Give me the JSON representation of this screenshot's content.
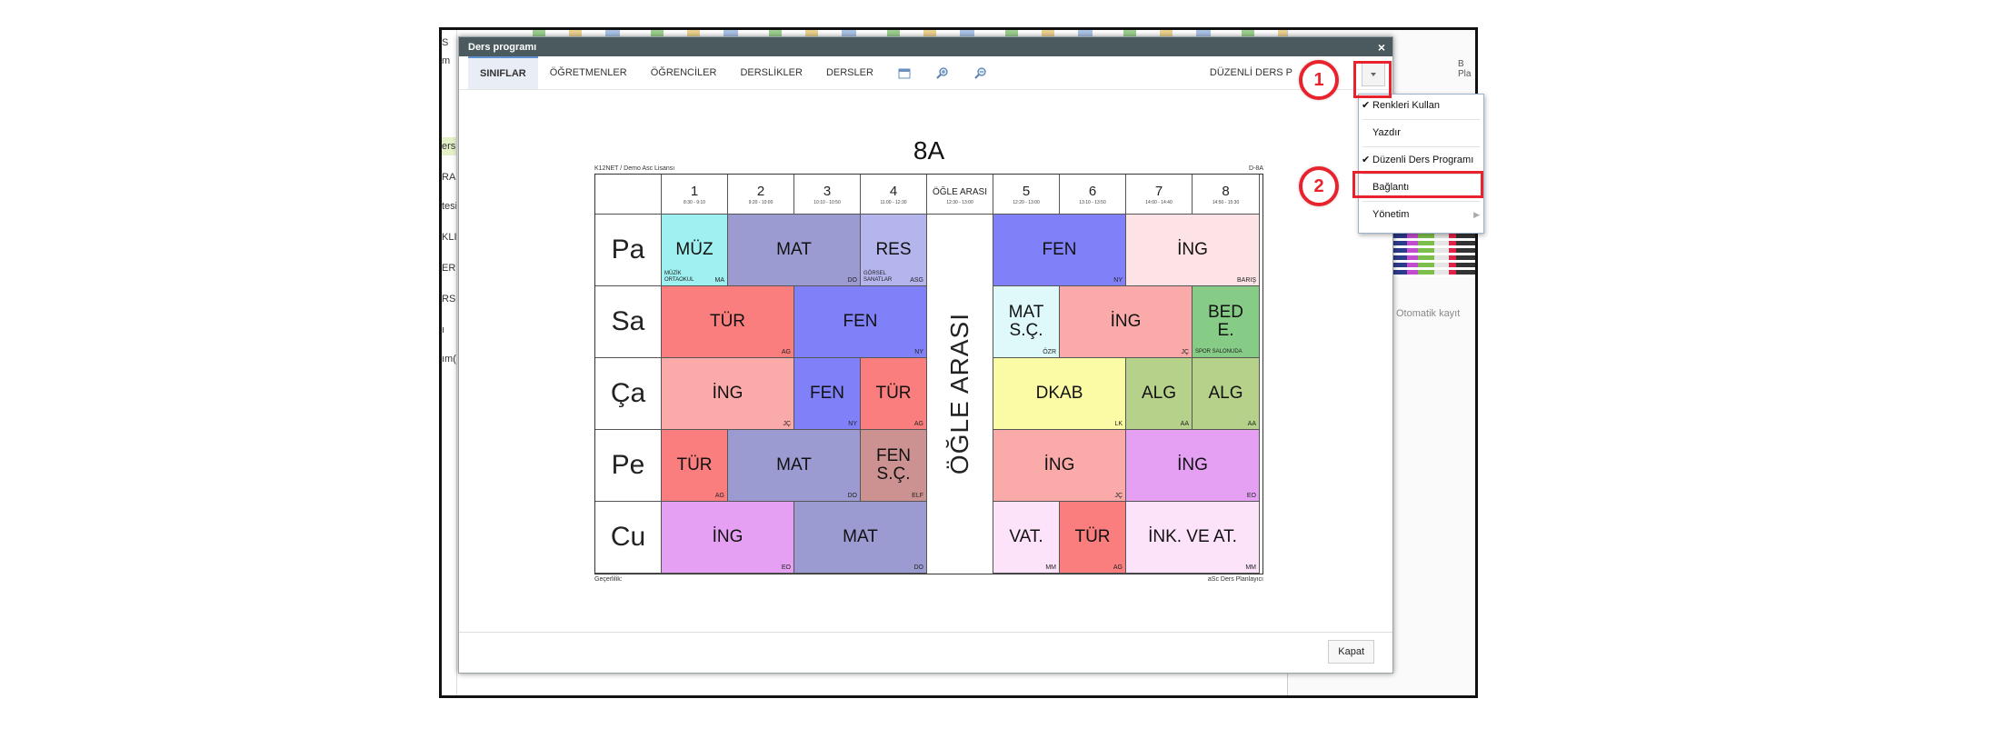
{
  "background": {
    "left_texts": [
      "S",
      "m",
      "ers",
      "RA",
      "tesi",
      "KLI",
      "ER",
      "RS",
      "ı",
      "ım("
    ],
    "right_small": "B\nPla",
    "auto_save": "Otomatik kayıt"
  },
  "dialog": {
    "title": "Ders programı",
    "close_glyph": "×",
    "mode_label": "DÜZENLİ DERS P",
    "close_button": "Kapat"
  },
  "tabs": [
    {
      "label": "SINIFLAR",
      "active": true
    },
    {
      "label": "ÖĞRETMENLER",
      "active": false
    },
    {
      "label": "ÖĞRENCİLER",
      "active": false
    },
    {
      "label": "DERSLİKLER",
      "active": false
    },
    {
      "label": "DERSLER",
      "active": false
    }
  ],
  "timetable": {
    "title": "8A",
    "license": "K12NET / Demo Asc Lisansı",
    "code": "D-8A",
    "validity": "Geçerlilik:",
    "footer_brand": "aSc Ders Planlayıcı",
    "lunch_header": "ÖĞLE ARASI",
    "lunch_time": "12:30 - 13:00",
    "lunch_vertical": "ÖĞLE ARASI",
    "periods": [
      {
        "num": "1",
        "time": "8:30 - 9:10"
      },
      {
        "num": "2",
        "time": "9:20 - 10:00"
      },
      {
        "num": "3",
        "time": "10:10 - 10:50"
      },
      {
        "num": "4",
        "time": "11:00 - 12:30"
      },
      {
        "num": "5",
        "time": "12:20 - 13:00"
      },
      {
        "num": "6",
        "time": "13:10 - 13:50"
      },
      {
        "num": "7",
        "time": "14:00 - 14:40"
      },
      {
        "num": "8",
        "time": "14:50 - 15:30"
      }
    ],
    "days": [
      "Pa",
      "Sa",
      "Ça",
      "Pe",
      "Cu"
    ],
    "lessons": [
      {
        "day": 0,
        "col": 2,
        "span": 1,
        "name": "MÜZ",
        "teacher": "MA",
        "room": "MÜZİK\nORTAOKUL",
        "color": "#9ff0f0"
      },
      {
        "day": 0,
        "col": 3,
        "span": 2,
        "name": "MAT",
        "teacher": "DO",
        "room": "",
        "color": "#9b9bd2"
      },
      {
        "day": 0,
        "col": 5,
        "span": 1,
        "name": "RES",
        "teacher": "ASG",
        "room": "GÖRSEL\nSANATLAR",
        "color": "#b5b5ee"
      },
      {
        "day": 0,
        "col": 7,
        "span": 2,
        "name": "FEN",
        "teacher": "NY",
        "room": "",
        "color": "#8080f8"
      },
      {
        "day": 0,
        "col": 9,
        "span": 2,
        "name": "İNG",
        "teacher": "BARIŞ",
        "room": "",
        "color": "#fde2e6"
      },
      {
        "day": 1,
        "col": 2,
        "span": 2,
        "name": "TÜR",
        "teacher": "AG",
        "room": "",
        "color": "#fa7e7e"
      },
      {
        "day": 1,
        "col": 4,
        "span": 2,
        "name": "FEN",
        "teacher": "NY",
        "room": "",
        "color": "#8080f8"
      },
      {
        "day": 1,
        "col": 7,
        "span": 1,
        "name": "MAT\nS.Ç.",
        "teacher": "ÖZR",
        "room": "",
        "color": "#dff9fb"
      },
      {
        "day": 1,
        "col": 8,
        "span": 2,
        "name": "İNG",
        "teacher": "JÇ",
        "room": "",
        "color": "#fbaaaa"
      },
      {
        "day": 1,
        "col": 10,
        "span": 1,
        "name": "BED\nE.",
        "teacher": "",
        "room": "SPOR SALONUDA",
        "color": "#86cc86"
      },
      {
        "day": 2,
        "col": 2,
        "span": 2,
        "name": "İNG",
        "teacher": "JÇ",
        "room": "",
        "color": "#fbaaaa"
      },
      {
        "day": 2,
        "col": 4,
        "span": 1,
        "name": "FEN",
        "teacher": "NY",
        "room": "",
        "color": "#8080f8"
      },
      {
        "day": 2,
        "col": 5,
        "span": 1,
        "name": "TÜR",
        "teacher": "AG",
        "room": "",
        "color": "#fa7e7e"
      },
      {
        "day": 2,
        "col": 7,
        "span": 2,
        "name": "DKAB",
        "teacher": "LK",
        "room": "",
        "color": "#fbfba6"
      },
      {
        "day": 2,
        "col": 9,
        "span": 1,
        "name": "ALG",
        "teacher": "AA",
        "room": "",
        "color": "#b6d18a"
      },
      {
        "day": 2,
        "col": 10,
        "span": 1,
        "name": "ALG",
        "teacher": "AA",
        "room": "",
        "color": "#b6d18a"
      },
      {
        "day": 3,
        "col": 2,
        "span": 1,
        "name": "TÜR",
        "teacher": "AG",
        "room": "",
        "color": "#fa7e7e"
      },
      {
        "day": 3,
        "col": 3,
        "span": 2,
        "name": "MAT",
        "teacher": "DO",
        "room": "",
        "color": "#9b9bd2"
      },
      {
        "day": 3,
        "col": 5,
        "span": 1,
        "name": "FEN\nS.Ç.",
        "teacher": "ELF",
        "room": "",
        "color": "#cc9292"
      },
      {
        "day": 3,
        "col": 7,
        "span": 2,
        "name": "İNG",
        "teacher": "JÇ",
        "room": "",
        "color": "#fbaaaa"
      },
      {
        "day": 3,
        "col": 9,
        "span": 2,
        "name": "İNG",
        "teacher": "EO",
        "room": "",
        "color": "#e5a0f3"
      },
      {
        "day": 4,
        "col": 2,
        "span": 2,
        "name": "İNG",
        "teacher": "EO",
        "room": "",
        "color": "#e5a0f3"
      },
      {
        "day": 4,
        "col": 4,
        "span": 2,
        "name": "MAT",
        "teacher": "DO",
        "room": "",
        "color": "#9b9bd2"
      },
      {
        "day": 4,
        "col": 7,
        "span": 1,
        "name": "VAT.",
        "teacher": "MM",
        "room": "",
        "color": "#fde3fa"
      },
      {
        "day": 4,
        "col": 8,
        "span": 1,
        "name": "TÜR",
        "teacher": "AG",
        "room": "",
        "color": "#fa7e7e"
      },
      {
        "day": 4,
        "col": 9,
        "span": 2,
        "name": "İNK. VE AT.",
        "teacher": "MM",
        "room": "",
        "color": "#fde3fa"
      }
    ]
  },
  "menu": {
    "items": [
      {
        "label": "Renkleri Kullan",
        "checked": true,
        "submenu": false
      },
      {
        "label": "Yazdır",
        "checked": false,
        "submenu": false
      },
      {
        "label": "Düzenli Ders Programı",
        "checked": true,
        "submenu": false
      },
      {
        "label": "Bağlantı",
        "checked": false,
        "submenu": false
      },
      {
        "label": "Yönetim",
        "checked": false,
        "submenu": true
      }
    ],
    "check_glyph": "✔",
    "submenu_glyph": "▶"
  },
  "annotations": [
    {
      "num": "1"
    },
    {
      "num": "2"
    }
  ],
  "colors": {
    "accent_red": "#e8232e",
    "titlebar": "#4a5a5f"
  }
}
